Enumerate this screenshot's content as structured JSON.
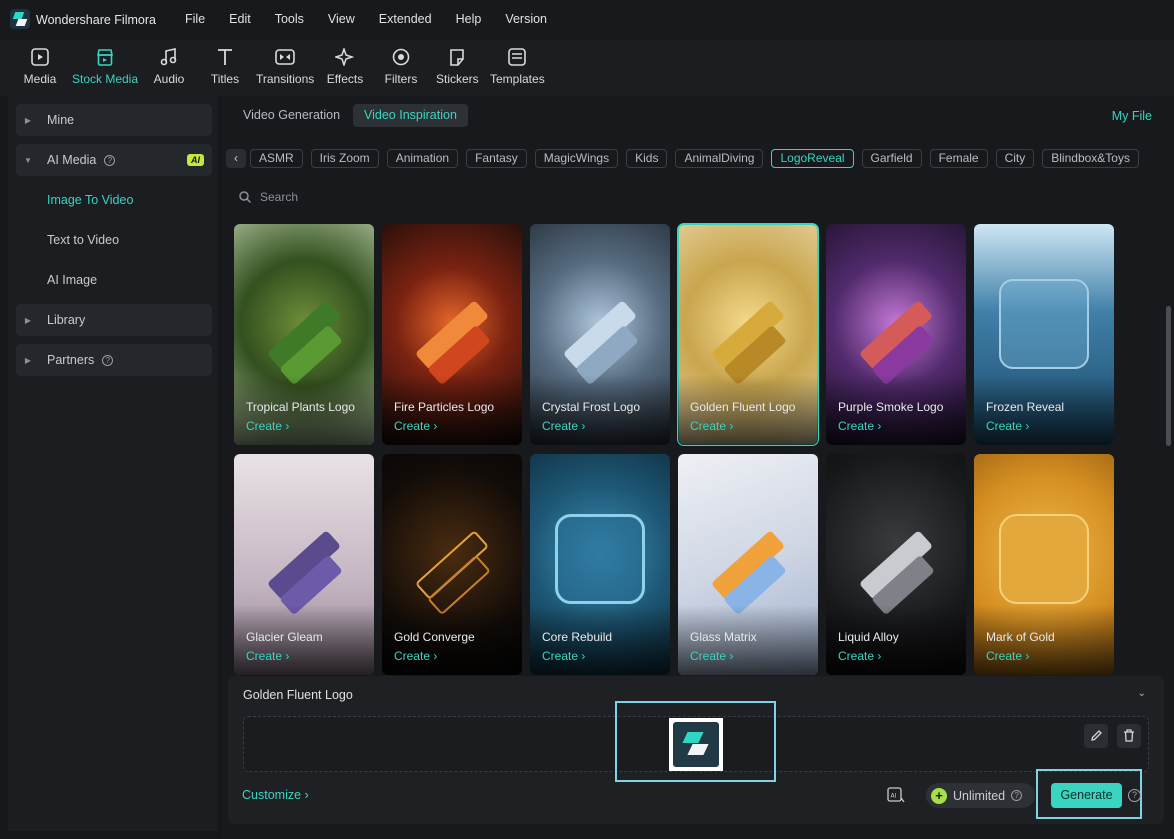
{
  "app": {
    "title": "Wondershare Filmora"
  },
  "menu": [
    "File",
    "Edit",
    "Tools",
    "View",
    "Extended",
    "Help",
    "Version"
  ],
  "toolbar": [
    {
      "label": "Media",
      "icon": "media-icon"
    },
    {
      "label": "Stock Media",
      "icon": "stock-media-icon",
      "active": true
    },
    {
      "label": "Audio",
      "icon": "music-note-icon"
    },
    {
      "label": "Titles",
      "icon": "text-t-icon"
    },
    {
      "label": "Transitions",
      "icon": "transition-icon"
    },
    {
      "label": "Effects",
      "icon": "sparkle-icon"
    },
    {
      "label": "Filters",
      "icon": "filter-icon"
    },
    {
      "label": "Stickers",
      "icon": "sticker-icon"
    },
    {
      "label": "Templates",
      "icon": "template-icon"
    }
  ],
  "sidebar": {
    "mine": "Mine",
    "ai_media": "AI Media",
    "ai_badge": "AI",
    "image_to_video": "Image To Video",
    "text_to_video": "Text to Video",
    "ai_image": "AI Image",
    "library": "Library",
    "partners": "Partners"
  },
  "tabs": {
    "video_generation": "Video Generation",
    "video_inspiration": "Video Inspiration",
    "my_file": "My File"
  },
  "chips": [
    "ASMR",
    "Iris Zoom",
    "Animation",
    "Fantasy",
    "MagicWings",
    "Kids",
    "AnimalDiving",
    "LogoReveal",
    "Garfield",
    "Female",
    "City",
    "Blindbox&Toys"
  ],
  "active_chip": "LogoReveal",
  "search": {
    "placeholder": "Search"
  },
  "cards": [
    {
      "title": "Tropical Plants Logo",
      "create": "Create ›"
    },
    {
      "title": "Fire Particles Logo",
      "create": "Create ›"
    },
    {
      "title": "Crystal Frost Logo",
      "create": "Create ›"
    },
    {
      "title": "Golden Fluent Logo",
      "create": "Create ›"
    },
    {
      "title": "Purple Smoke Logo",
      "create": "Create ›"
    },
    {
      "title": "Frozen Reveal",
      "create": "Create ›"
    },
    {
      "title": "Glacier Gleam",
      "create": "Create ›"
    },
    {
      "title": "Gold Converge",
      "create": "Create ›"
    },
    {
      "title": "Core Rebuild",
      "create": "Create ›"
    },
    {
      "title": "Glass Matrix",
      "create": "Create ›"
    },
    {
      "title": "Liquid Alloy",
      "create": "Create ›"
    },
    {
      "title": "Mark of Gold",
      "create": "Create ›"
    }
  ],
  "bottom": {
    "title": "Golden Fluent Logo",
    "customize": "Customize ›",
    "unlimited": "Unlimited",
    "generate": "Generate"
  },
  "colors": {
    "accent": "#39d5c0",
    "highlight_frame": "#7fd3e6",
    "ai_badge": "#c5e83a"
  }
}
